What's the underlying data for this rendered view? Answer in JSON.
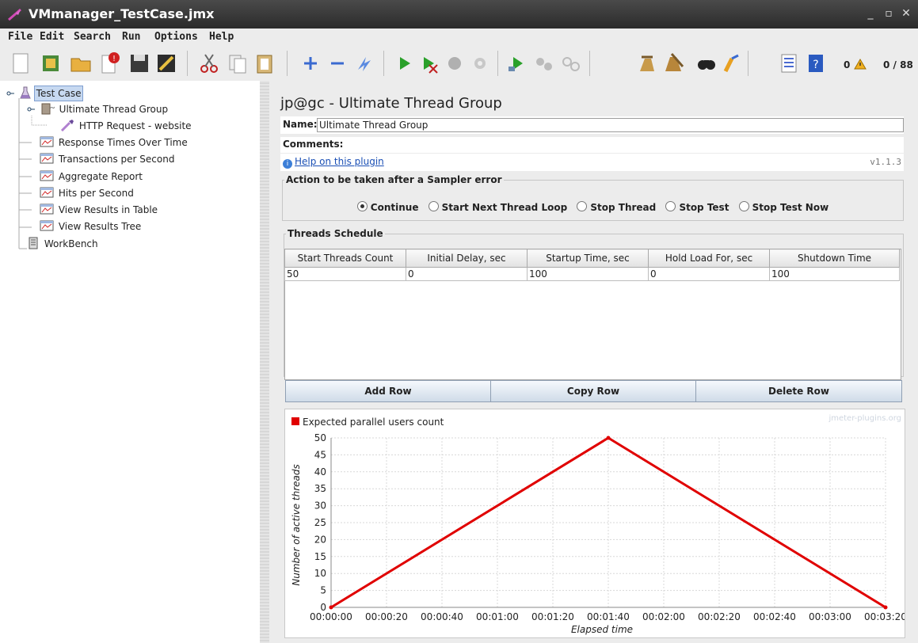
{
  "window": {
    "title": "VMmanager_TestCase.jmx",
    "minimize": "_",
    "maximize": "▫",
    "close": "✕"
  },
  "menu": [
    "File",
    "Edit",
    "Search",
    "Run",
    "Options",
    "Help"
  ],
  "toolbar": {
    "warning_count": "0",
    "thread_count": "0 / 88"
  },
  "tree": {
    "root": "Test Case",
    "thread_group": "Ultimate Thread Group",
    "sampler": "HTTP Request - website",
    "listeners": [
      "Response Times Over Time",
      "Transactions per Second",
      "Aggregate Report",
      "Hits per Second",
      "View Results in Table",
      "View Results Tree"
    ],
    "workbench": "WorkBench"
  },
  "panel": {
    "title": "jp@gc - Ultimate Thread Group",
    "name_label": "Name:",
    "name_value": "Ultimate Thread Group",
    "comments_label": "Comments:",
    "help_link": "Help on this plugin",
    "version": "v1.1.3",
    "error_action": {
      "legend": "Action to be taken after a Sampler error",
      "options": [
        "Continue",
        "Start Next Thread Loop",
        "Stop Thread",
        "Stop Test",
        "Stop Test Now"
      ],
      "selected": "Continue"
    },
    "schedule": {
      "legend": "Threads Schedule",
      "columns": [
        "Start Threads Count",
        "Initial Delay, sec",
        "Startup Time, sec",
        "Hold Load For, sec",
        "Shutdown Time"
      ],
      "rows": [
        [
          "50",
          "0",
          "100",
          "0",
          "100"
        ]
      ]
    },
    "buttons": {
      "add": "Add Row",
      "copy": "Copy Row",
      "delete": "Delete Row"
    }
  },
  "chart_data": {
    "type": "line",
    "watermark": "jmeter-plugins.org",
    "series": [
      {
        "name": "Expected parallel users count",
        "color": "#e00000",
        "x_seconds": [
          0,
          100,
          200
        ],
        "values": [
          0,
          50,
          0
        ]
      }
    ],
    "xlabel": "Elapsed time",
    "ylabel": "Number of active threads",
    "x_ticks": [
      "00:00:00",
      "00:00:20",
      "00:00:40",
      "00:01:00",
      "00:01:20",
      "00:01:40",
      "00:02:00",
      "00:02:20",
      "00:02:40",
      "00:03:00",
      "00:03:20"
    ],
    "y_ticks": [
      0,
      5,
      10,
      15,
      20,
      25,
      30,
      35,
      40,
      45,
      50
    ],
    "xlim_seconds": [
      0,
      200
    ],
    "ylim": [
      0,
      50
    ],
    "grid": true,
    "legend": "top-left"
  }
}
